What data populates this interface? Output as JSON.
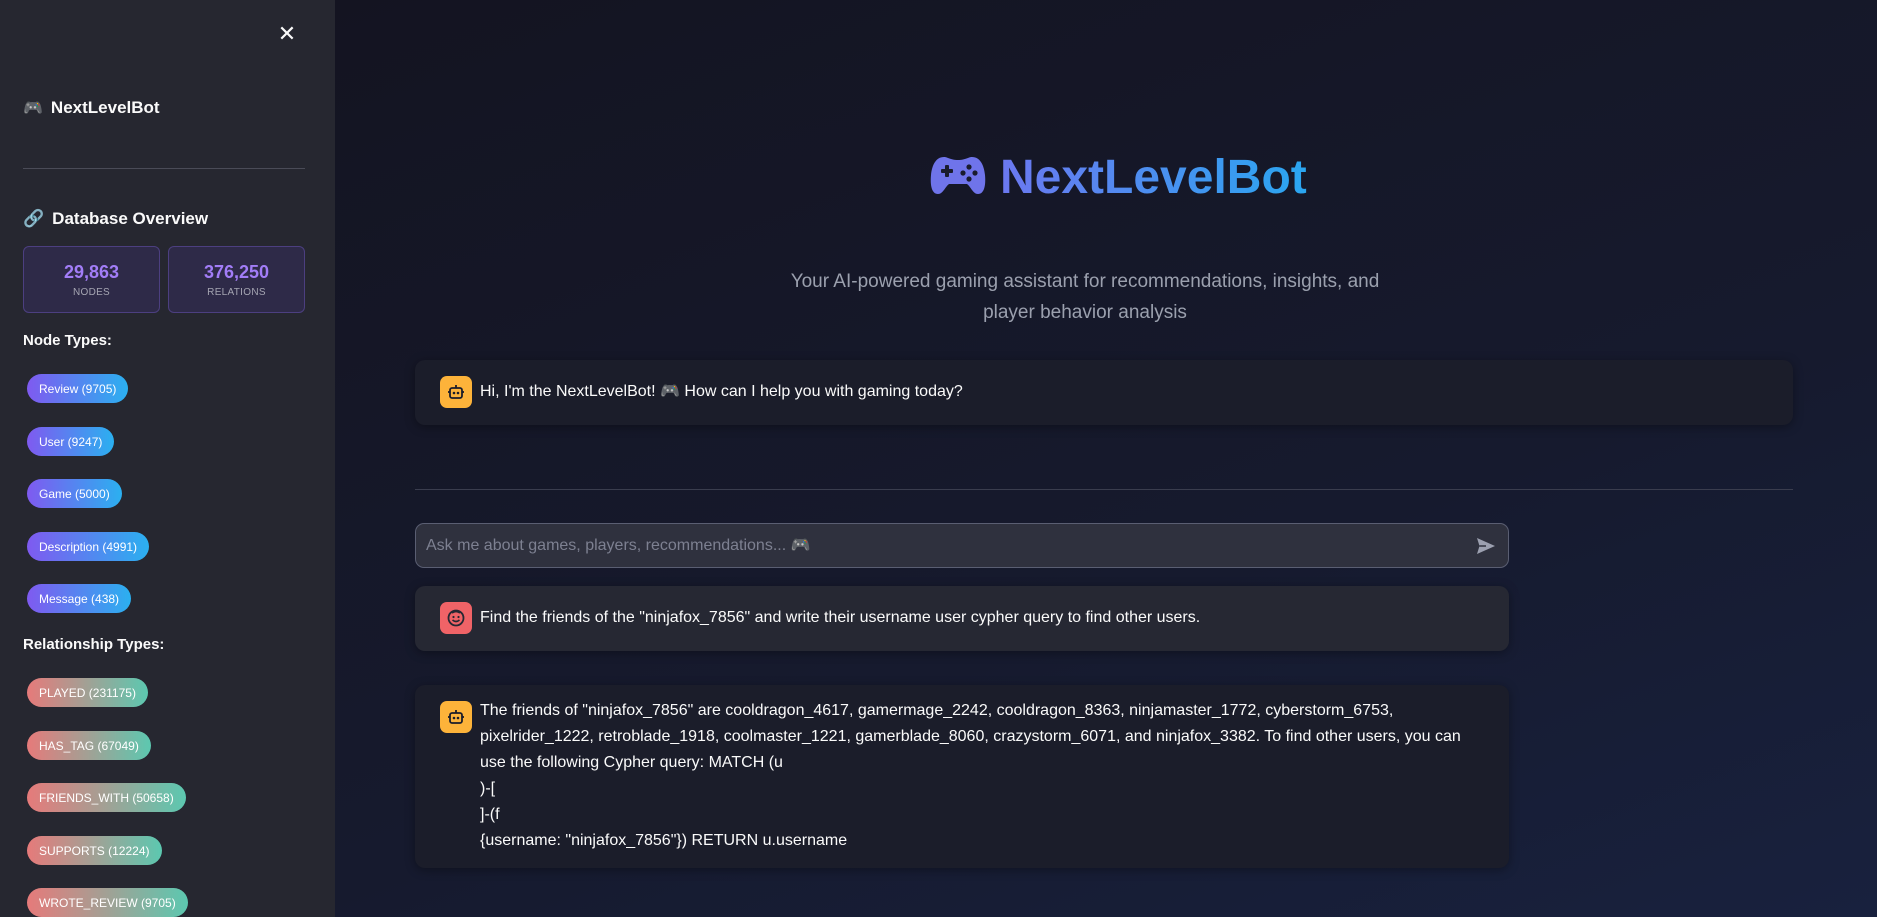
{
  "sidebar": {
    "close_label": "✕",
    "app_title_emoji": "🎮",
    "app_title": "NextLevelBot",
    "db_title_emoji": "🔗",
    "db_title": "Database Overview",
    "stats": {
      "nodes_value": "29,863",
      "nodes_label": "NODES",
      "relations_value": "376,250",
      "relations_label": "RELATIONS"
    },
    "node_types_label": "Node Types:",
    "node_types": [
      "Review (9705)",
      "User (9247)",
      "Game (5000)",
      "Description (4991)",
      "Message (438)"
    ],
    "relationship_types_label": "Relationship Types:",
    "relationship_types": [
      "PLAYED (231175)",
      "HAS_TAG (67049)",
      "FRIENDS_WITH (50658)",
      "SUPPORTS (12224)",
      "WROTE_REVIEW (9705)"
    ]
  },
  "hero": {
    "icon": "gamepad-icon",
    "title": "NextLevelBot",
    "subtitle": "Your AI-powered gaming assistant for recommendations, insights, and player behavior analysis"
  },
  "messages": {
    "greeting": "Hi, I'm the NextLevelBot! 🎮 How can I help you with gaming today?",
    "user_query": "Find the friends of the \"ninjafox_7856\" and write their username user cypher query to find other users.",
    "bot_reply_lines": [
      "The friends of \"ninjafox_7856\" are cooldragon_4617, gamermage_2242, cooldragon_8363, ninjamaster_1772, cyberstorm_6753, pixelrider_1222, retroblade_1918, coolmaster_1221, gamerblade_8060, crazystorm_6071, and ninjafox_3382. To find other users, you can use the following Cypher query: MATCH (u",
      ")-[",
      "]-(f",
      "{username: \"ninjafox_7856\"}) RETURN u.username"
    ]
  },
  "chat_input": {
    "value": "",
    "placeholder": "Ask me about games, players, recommendations... 🎮"
  },
  "colors": {
    "accent_purple": "#a27df7",
    "bot_avatar": "#fdb33a",
    "user_avatar": "#f06367"
  }
}
